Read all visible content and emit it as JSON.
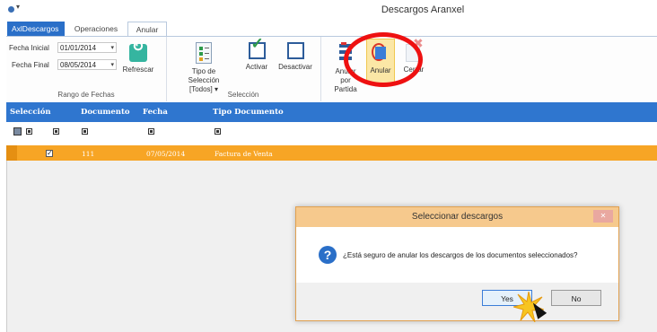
{
  "window": {
    "title": "Descargos Aranxel"
  },
  "tabs": [
    {
      "label": "AxlDescargos"
    },
    {
      "label": "Operaciones"
    },
    {
      "label": "Anular"
    }
  ],
  "ribbon": {
    "fechas": {
      "inicial_label": "Fecha Inicial",
      "inicial_value": "01/01/2014",
      "final_label": "Fecha Final",
      "final_value": "08/05/2014",
      "refrescar": "Refrescar",
      "group_label": "Rango de Fechas"
    },
    "seleccion": {
      "tipo_label": "Tipo de Selección",
      "tipo_value": "[Todos] ▾",
      "activar": "Activar",
      "desactivar": "Desactivar",
      "group_label": "Selección"
    },
    "anular": {
      "anular_parcial": "Anular por Partida",
      "anular": "Anular",
      "cerrar": "Cerrar"
    }
  },
  "grid": {
    "columns": [
      "Selección",
      "Documento",
      "Fecha",
      "Tipo Documento"
    ],
    "rows": [
      {
        "selected": "✓",
        "documento": "111",
        "fecha": "07/05/2014",
        "tipo": "Factura de Venta"
      }
    ]
  },
  "dialog": {
    "title": "Seleccionar descargos",
    "close": "✕",
    "message": "¿Está seguro de anular los descargos de los documentos seleccionados?",
    "yes": "Yes",
    "no": "No"
  },
  "colors": {
    "header_blue": "#2f76cf",
    "row_orange": "#f7a525",
    "highlight_ring": "#e11111"
  }
}
